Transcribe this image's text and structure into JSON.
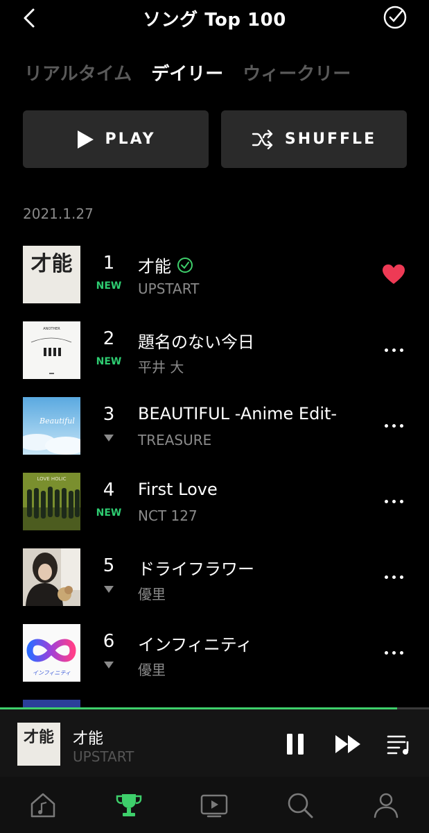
{
  "header": {
    "title": "ソング Top 100"
  },
  "tabs": [
    {
      "label": "リアルタイム",
      "active": false
    },
    {
      "label": "デイリー",
      "active": true
    },
    {
      "label": "ウィークリー",
      "active": false
    }
  ],
  "actions": {
    "play_label": "PLAY",
    "shuffle_label": "SHUFFLE"
  },
  "date": "2021.1.27",
  "songs": [
    {
      "rank": "1",
      "change": "NEW",
      "title": "才能",
      "artist": "UPSTART",
      "verified": true,
      "liked": true
    },
    {
      "rank": "2",
      "change": "NEW",
      "title": "題名のない今日",
      "artist": "平井 大"
    },
    {
      "rank": "3",
      "change": "down",
      "title": "BEAUTIFUL -Anime Edit-",
      "artist": "TREASURE"
    },
    {
      "rank": "4",
      "change": "NEW",
      "title": "First Love",
      "artist": "NCT 127"
    },
    {
      "rank": "5",
      "change": "down",
      "title": "ドライフラワー",
      "artist": "優里"
    },
    {
      "rank": "6",
      "change": "down",
      "title": "インフィニティ",
      "artist": "優里"
    }
  ],
  "album_art": {
    "1": {
      "text": "才能"
    },
    "2": {
      "text": "ANOTHER"
    },
    "3": {
      "text": "Beautiful"
    },
    "4": {
      "text": "LOVE HOLIC"
    },
    "6": {
      "text": "インフィニティ"
    }
  },
  "player": {
    "title": "才能",
    "artist": "UPSTART",
    "progress": 0.925,
    "art_text": "才能"
  },
  "nav": [
    "home-music-icon",
    "trophy-icon",
    "video-icon",
    "search-icon",
    "profile-icon"
  ],
  "colors": {
    "accent": "#3ecf6b",
    "heart": "#ee3a55",
    "muted": "#8a8a8a"
  }
}
